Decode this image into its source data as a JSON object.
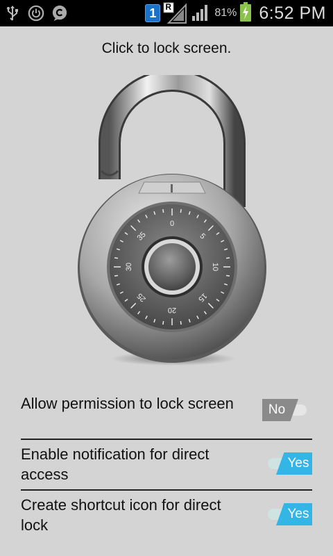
{
  "status_bar": {
    "icons_left": [
      "usb-icon",
      "power-icon",
      "chat-icon"
    ],
    "sim_badge": "1",
    "roaming_badge": "R",
    "battery_percent": "81%",
    "time": "6:52 PM"
  },
  "main": {
    "title": "Click to lock screen.",
    "dial_numbers": [
      "0",
      "5",
      "10",
      "15",
      "20",
      "25",
      "30",
      "35"
    ]
  },
  "settings": [
    {
      "label": "Allow permission to lock screen",
      "toggle_text": "No",
      "state": "off"
    },
    {
      "label": "Enable notification for direct access",
      "toggle_text": "Yes",
      "state": "on"
    },
    {
      "label": "Create shortcut icon for direct lock",
      "toggle_text": "Yes",
      "state": "on"
    }
  ],
  "colors": {
    "background": "#d4d4d4",
    "status_bar": "#000000",
    "toggle_on": "#33b5e5",
    "toggle_off": "#8a8a8a"
  }
}
